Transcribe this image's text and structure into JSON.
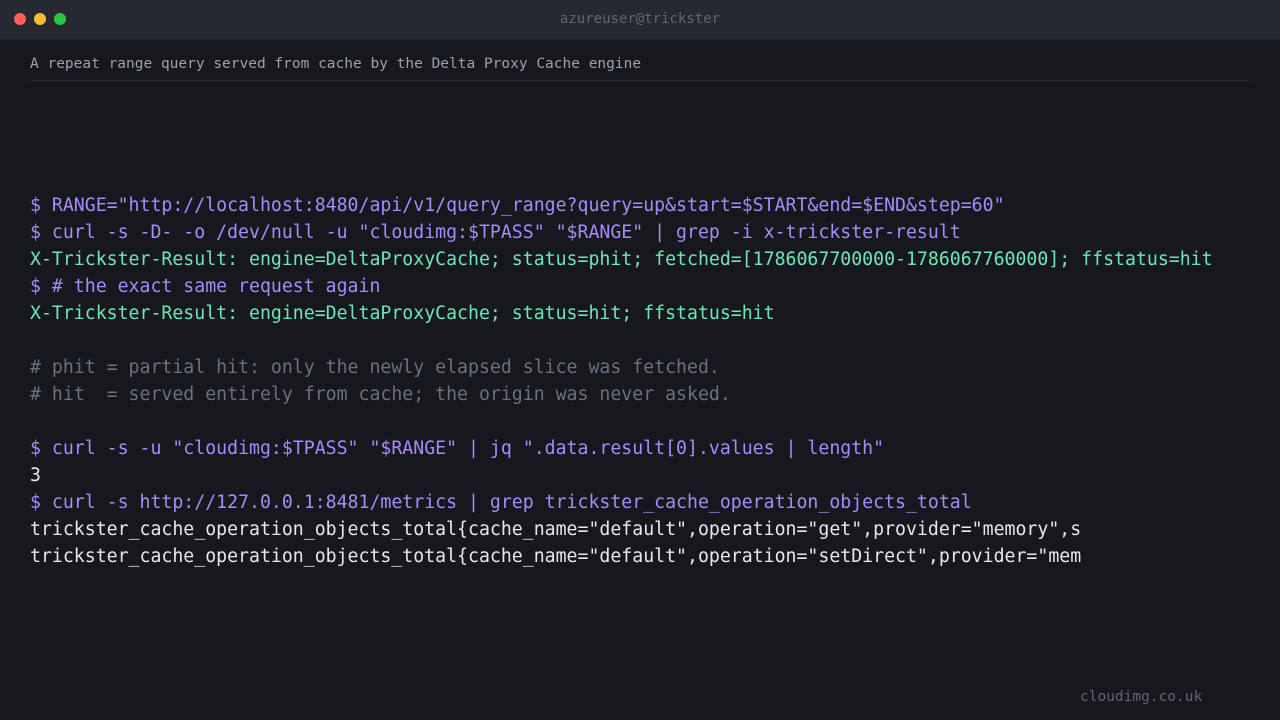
{
  "window": {
    "title": "azureuser@trickster"
  },
  "caption": "A repeat range query served from cache by the Delta Proxy Cache engine",
  "lines": [
    {
      "text": "$ RANGE=\"http://localhost:8480/api/v1/query_range?query=up&start=$START&end=$END&step=60\"",
      "kind": "cmd"
    },
    {
      "text": "$ curl -s -D- -o /dev/null -u \"cloudimg:$TPASS\" \"$RANGE\" | grep -i x-trickster-result",
      "kind": "cmd"
    },
    {
      "text": "X-Trickster-Result: engine=DeltaProxyCache; status=phit; fetched=[1786067700000-1786067760000]; ffstatus=hit",
      "kind": "result"
    },
    {
      "text": "$ # the exact same request again",
      "kind": "cmd"
    },
    {
      "text": "X-Trickster-Result: engine=DeltaProxyCache; status=hit; ffstatus=hit",
      "kind": "result"
    },
    {
      "text": "",
      "kind": "blank"
    },
    {
      "text": "# phit = partial hit: only the newly elapsed slice was fetched.",
      "kind": "comment"
    },
    {
      "text": "# hit  = served entirely from cache; the origin was never asked.",
      "kind": "comment"
    },
    {
      "text": "",
      "kind": "blank"
    },
    {
      "text": "$ curl -s -u \"cloudimg:$TPASS\" \"$RANGE\" | jq \".data.result[0].values | length\"",
      "kind": "cmd"
    },
    {
      "text": "3",
      "kind": "plain"
    },
    {
      "text": "$ curl -s http://127.0.0.1:8481/metrics | grep trickster_cache_operation_objects_total",
      "kind": "cmd"
    },
    {
      "text": "trickster_cache_operation_objects_total{cache_name=\"default\",operation=\"get\",provider=\"memory\",s",
      "kind": "plain"
    },
    {
      "text": "trickster_cache_operation_objects_total{cache_name=\"default\",operation=\"setDirect\",provider=\"mem",
      "kind": "plain"
    }
  ],
  "footer": "cloudimg.co.uk",
  "colors": {
    "background": "#17181d",
    "titlebar": "#262931",
    "command": "#a78bfa",
    "result": "#6ee7b7",
    "comment": "#6b7080",
    "plain": "#e8e8ea"
  }
}
